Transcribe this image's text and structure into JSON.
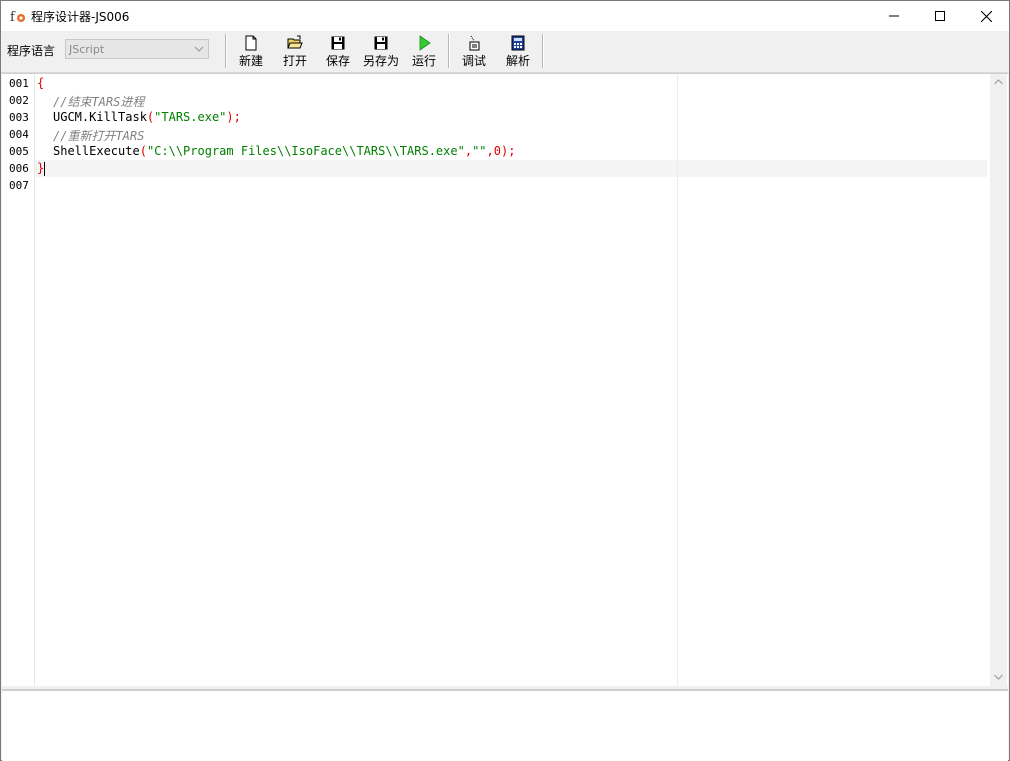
{
  "window": {
    "title": "程序设计器-JS006",
    "controls": [
      "minimize",
      "maximize",
      "close"
    ]
  },
  "toolbar": {
    "language_label": "程序语言",
    "language_value": "JScript",
    "buttons": [
      {
        "label": "新建",
        "icon": "new-file-icon"
      },
      {
        "label": "打开",
        "icon": "open-folder-icon"
      },
      {
        "label": "保存",
        "icon": "floppy-disk-icon"
      },
      {
        "label": "另存为",
        "icon": "save-as-icon"
      },
      {
        "label": "运行",
        "icon": "run-play-icon"
      },
      {
        "label": "调试",
        "icon": "debug-icon"
      },
      {
        "label": "解析",
        "icon": "parse-calculator-icon"
      }
    ]
  },
  "editor": {
    "line_numbers": [
      "001",
      "002",
      "003",
      "004",
      "005",
      "006",
      "007"
    ],
    "lines": {
      "l1_brace": "{",
      "l2_comment": "//结束TARS进程",
      "l3_call": "UGCM.KillTask",
      "l3_open": "(",
      "l3_str": "\"TARS.exe\"",
      "l3_close": ");",
      "l4_comment": "//重新打开TARS",
      "l5_call": "ShellExecute",
      "l5_open": "(",
      "l5_str1": "\"C:\\\\Program Files\\\\IsoFace\\\\TARS\\\\TARS.exe\"",
      "l5_comma1": ",",
      "l5_str2": "\"\"",
      "l5_comma2": ",",
      "l5_num": "0",
      "l5_close": ");",
      "l6_brace": "}"
    },
    "colors": {
      "punctuation": "#e00000",
      "comment": "#808080",
      "string": "#008000"
    }
  },
  "output": {
    "text": ""
  }
}
